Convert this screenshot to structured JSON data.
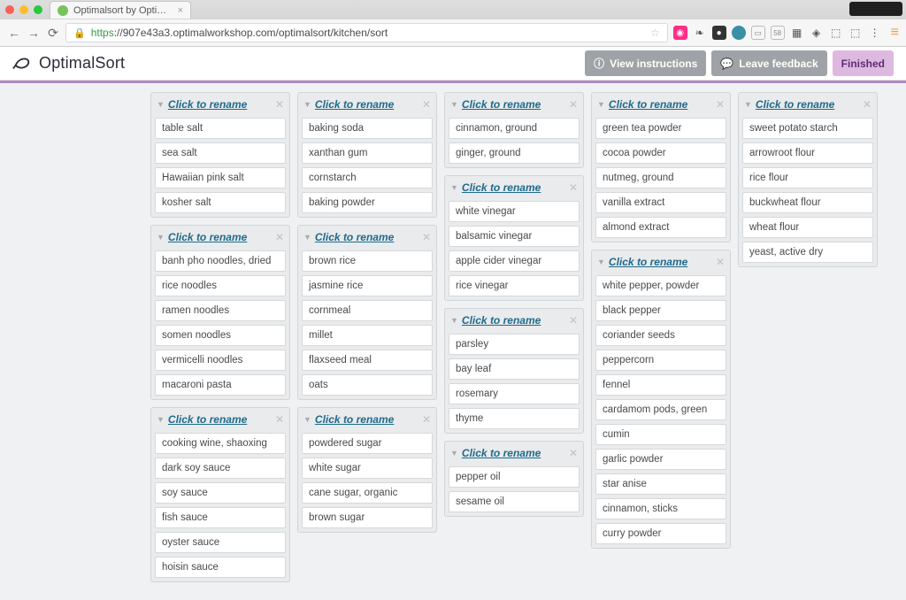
{
  "tab_title": "Optimalsort by Optimal W",
  "url_secure_part": "https",
  "url_rest": "://907e43a3.optimalworkshop.com/optimalsort/kitchen/sort",
  "brand": "OptimalSort",
  "buttons": {
    "view_instructions": "View instructions",
    "leave_feedback": "Leave feedback",
    "finished": "Finished"
  },
  "rename_label": "Click to rename",
  "columns": [
    {
      "groups": [
        {
          "cards": [
            "table salt",
            "sea salt",
            "Hawaiian pink salt",
            "kosher salt"
          ]
        },
        {
          "cards": [
            "banh pho noodles, dried",
            "rice noodles",
            "ramen noodles",
            "somen noodles",
            "vermicelli noodles",
            "macaroni pasta"
          ]
        },
        {
          "cards": [
            "cooking wine, shaoxing",
            "dark soy sauce",
            "soy sauce",
            "fish sauce",
            "oyster sauce",
            "hoisin sauce"
          ]
        }
      ]
    },
    {
      "groups": [
        {
          "cards": [
            "baking soda",
            "xanthan gum",
            "cornstarch",
            "baking powder"
          ]
        },
        {
          "cards": [
            "brown rice",
            "jasmine rice",
            "cornmeal",
            "millet",
            "flaxseed meal",
            "oats"
          ]
        },
        {
          "cards": [
            "powdered sugar",
            "white sugar",
            "cane sugar, organic",
            "brown sugar"
          ]
        }
      ]
    },
    {
      "groups": [
        {
          "cards": [
            "cinnamon, ground",
            "ginger, ground"
          ]
        },
        {
          "cards": [
            "white vinegar",
            "balsamic vinegar",
            "apple cider vinegar",
            "rice vinegar"
          ]
        },
        {
          "cards": [
            "parsley",
            "bay leaf",
            "rosemary",
            "thyme"
          ]
        },
        {
          "cards": [
            "pepper oil",
            "sesame oil"
          ]
        }
      ]
    },
    {
      "groups": [
        {
          "cards": [
            "green tea powder",
            "cocoa powder",
            "nutmeg, ground",
            "vanilla extract",
            "almond extract"
          ]
        },
        {
          "cards": [
            "white pepper, powder",
            "black pepper",
            "coriander seeds",
            "peppercorn",
            "fennel",
            "cardamom pods, green",
            "cumin",
            "garlic powder",
            "star anise",
            "cinnamon, sticks",
            "curry powder"
          ]
        }
      ]
    },
    {
      "groups": [
        {
          "cards": [
            "sweet potato starch",
            "arrowroot flour",
            "rice flour",
            "buckwheat flour",
            "wheat flour",
            "yeast, active dry"
          ]
        }
      ]
    }
  ]
}
